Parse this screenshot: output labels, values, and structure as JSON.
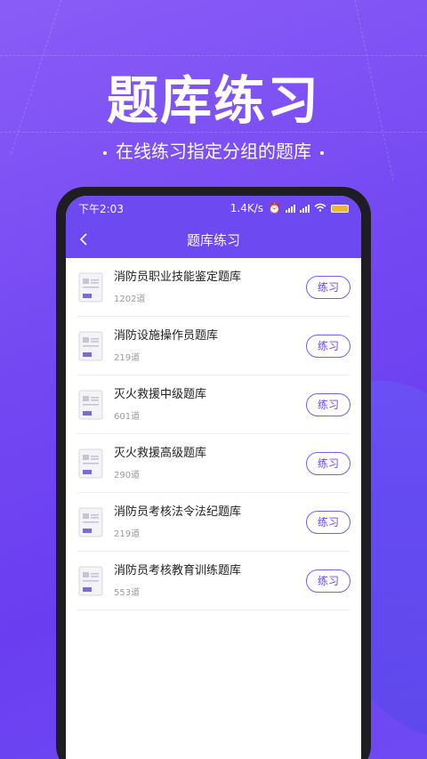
{
  "hero": {
    "title": "题库练习",
    "subtitle": "在线练习指定分组的题库"
  },
  "status_bar": {
    "time": "下午2:03",
    "network_speed": "1.4K/s",
    "battery_label": "61"
  },
  "nav": {
    "title": "题库练习",
    "back_icon": "chevron-left-icon"
  },
  "question_banks": [
    {
      "name": "消防员职业技能鉴定题库",
      "count": "1202道",
      "button": "练习"
    },
    {
      "name": "消防设施操作员题库",
      "count": "219道",
      "button": "练习"
    },
    {
      "name": "灭火救援中级题库",
      "count": "601道",
      "button": "练习"
    },
    {
      "name": "灭火救援高级题库",
      "count": "290道",
      "button": "练习"
    },
    {
      "name": "消防员考核法令法纪题库",
      "count": "219道",
      "button": "练习"
    },
    {
      "name": "消防员考核教育训练题库",
      "count": "553道",
      "button": "练习"
    }
  ],
  "colors": {
    "accent": "#6d49f1",
    "button_border": "#7b5cf2",
    "background": "#7449f2"
  }
}
